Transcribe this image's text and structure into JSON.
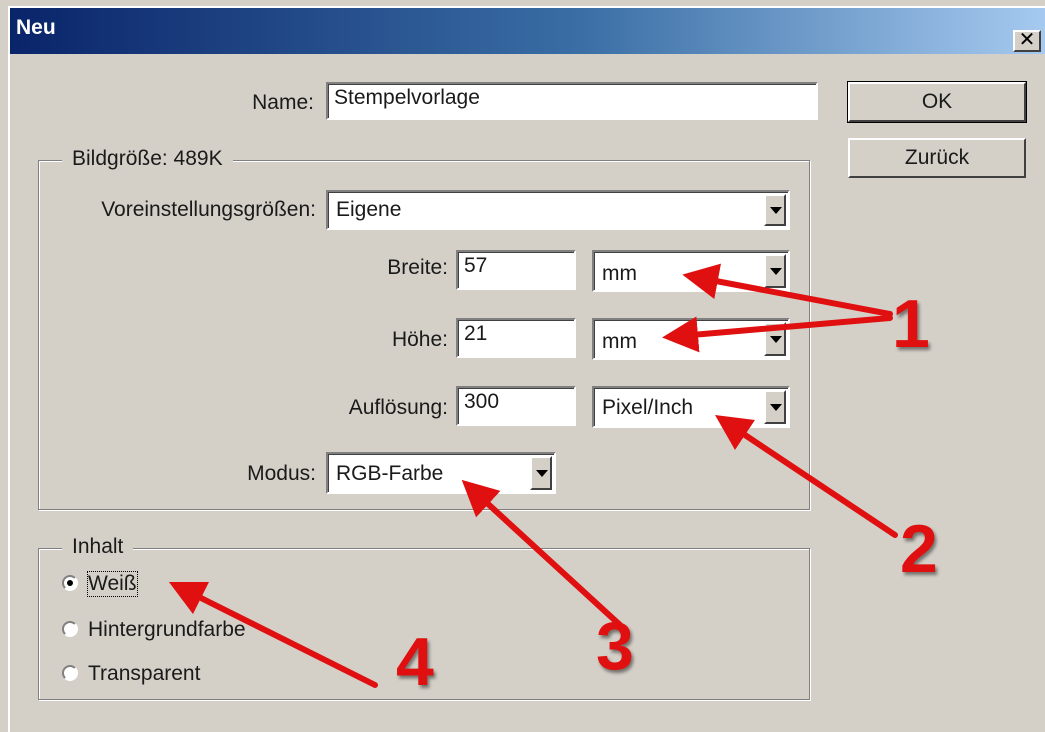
{
  "window": {
    "title": "Neu",
    "close_glyph": "✕"
  },
  "buttons": {
    "ok": "OK",
    "reset": "Zurück"
  },
  "form": {
    "name_label": "Name:",
    "name_value": "Stempelvorlage",
    "image_size_title": "Bildgröße: 489K",
    "preset_label": "Voreinstellungsgrößen:",
    "preset_value": "Eigene",
    "width_label": "Breite:",
    "width_value": "57",
    "width_unit": "mm",
    "height_label": "Höhe:",
    "height_value": "21",
    "height_unit": "mm",
    "resolution_label": "Auflösung:",
    "resolution_value": "300",
    "resolution_unit": "Pixel/Inch",
    "mode_label": "Modus:",
    "mode_value": "RGB-Farbe"
  },
  "content": {
    "title": "Inhalt",
    "options": [
      {
        "label": "Weiß",
        "checked": true
      },
      {
        "label": "Hintergrundfarbe",
        "checked": false
      },
      {
        "label": "Transparent",
        "checked": false
      }
    ]
  },
  "annotations": {
    "a1": "1",
    "a2": "2",
    "a3": "3",
    "a4": "4",
    "color": "#e01010"
  },
  "icons": {
    "close": "close-icon",
    "dropdown": "chevron-down-icon",
    "radio": "radio-icon"
  }
}
